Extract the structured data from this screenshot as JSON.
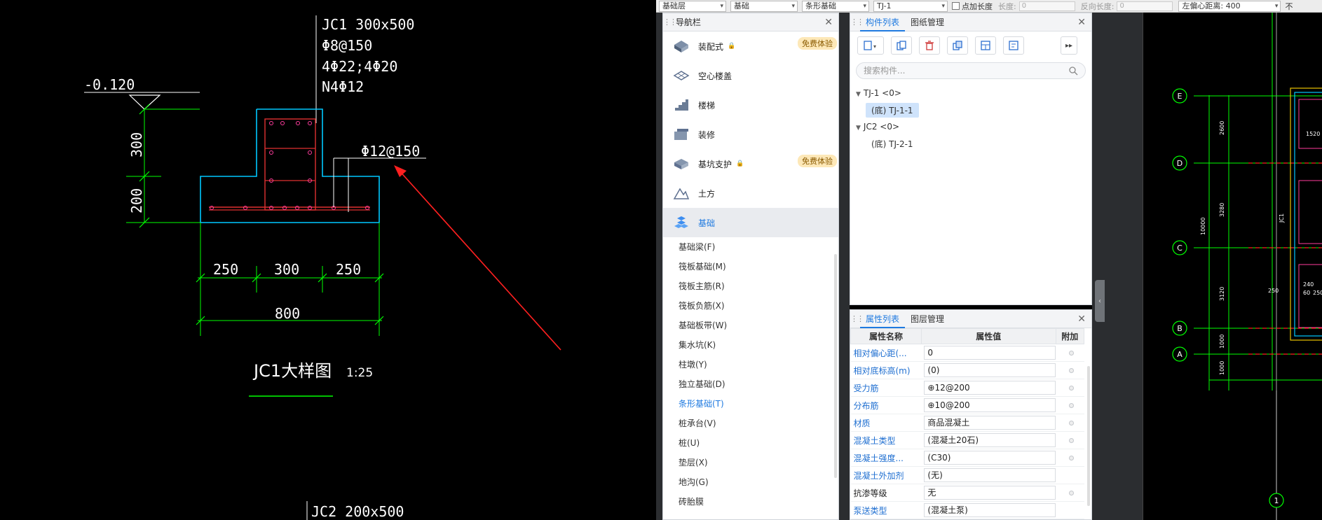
{
  "top_strip": {
    "combo1": "基础层",
    "combo2": "基础",
    "combo3": "条形基础",
    "combo4": "TJ-1",
    "add_length_label": "点加长度",
    "length_label": "长度:",
    "length_value": "0",
    "reverse_length_label": "反向长度:",
    "reverse_length_value": "0",
    "left_offset": "左偏心距离: 400",
    "right_cut": "不"
  },
  "drawing": {
    "elev_label": "-0.120",
    "header_line1": "JC1 300x500",
    "header_line2": "Φ8@150",
    "header_line3": "4Φ22;4Φ20",
    "header_line4": "N4Φ12",
    "rebar_label": "Φ12@150",
    "dim_300_v": "300",
    "dim_200_v": "200",
    "dim_250_a": "250",
    "dim_300_h": "300",
    "dim_250_b": "250",
    "dim_800": "800",
    "title": "JC1大样图",
    "scale": "1:25",
    "bottom_label": "JC2 200x500"
  },
  "nav": {
    "title": "导航栏",
    "main_items": [
      {
        "label": "装配式",
        "lock": true,
        "badge": "免费体验",
        "icon": "prefab-icon"
      },
      {
        "label": "空心楼盖",
        "lock": false,
        "badge": "",
        "icon": "hollow-slab-icon"
      },
      {
        "label": "楼梯",
        "lock": false,
        "badge": "",
        "icon": "stairs-icon"
      },
      {
        "label": "装修",
        "lock": false,
        "badge": "",
        "icon": "decoration-icon"
      },
      {
        "label": "基坑支护",
        "lock": true,
        "badge": "免费体验",
        "icon": "pit-support-icon"
      },
      {
        "label": "土方",
        "lock": false,
        "badge": "",
        "icon": "earthwork-icon"
      },
      {
        "label": "基础",
        "lock": false,
        "badge": "",
        "icon": "foundation-icon"
      }
    ],
    "sub_items": [
      "基础梁(F)",
      "筏板基础(M)",
      "筏板主筋(R)",
      "筏板负筋(X)",
      "基础板带(W)",
      "集水坑(K)",
      "柱墩(Y)",
      "独立基础(D)",
      "条形基础(T)",
      "桩承台(V)",
      "桩(U)",
      "垫层(X)",
      "地沟(G)",
      "砖胎膜"
    ]
  },
  "component_panel": {
    "tab1": "构件列表",
    "tab2": "图纸管理",
    "search_placeholder": "搜索构件...",
    "group1": "TJ-1 <0>",
    "item1": "(底) TJ-1-1",
    "group2": "JC2 <0>",
    "item2": "(底) TJ-2-1"
  },
  "property_panel": {
    "tab1": "属性列表",
    "tab2": "图层管理",
    "col_name": "属性名称",
    "col_value": "属性值",
    "col_add": "附加",
    "rows": [
      {
        "name": "相对偏心距(...",
        "value": "0",
        "blue": true,
        "check": true
      },
      {
        "name": "相对底标高(m)",
        "value": "(0)",
        "blue": true,
        "check": true
      },
      {
        "name": "受力筋",
        "value": "⊕12@200",
        "blue": true,
        "check": true
      },
      {
        "name": "分布筋",
        "value": "⊕10@200",
        "blue": true,
        "check": true
      },
      {
        "name": "材质",
        "value": "商品混凝土",
        "blue": true,
        "check": true
      },
      {
        "name": "混凝土类型",
        "value": "(混凝土20石)",
        "blue": true,
        "check": true
      },
      {
        "name": "混凝土强度...",
        "value": "(C30)",
        "blue": true,
        "check": true
      },
      {
        "name": "混凝土外加剂",
        "value": "(无)",
        "blue": true,
        "check": false
      },
      {
        "name": "抗渗等级",
        "value": "无",
        "blue": false,
        "check": true
      },
      {
        "name": "泵送类型",
        "value": "(混凝土泵)",
        "blue": true,
        "check": false
      }
    ]
  },
  "plan": {
    "axes": [
      "E",
      "D",
      "C",
      "B",
      "A",
      "1"
    ],
    "dims": [
      "2600",
      "3280",
      "3120",
      "1000",
      "1000",
      "10000",
      "1520",
      "240",
      "60",
      "250",
      "250",
      "JC1"
    ]
  },
  "colors": {
    "accent": "#1f7ae0",
    "cad_bg": "#000000",
    "cad_green": "#00ff00",
    "cad_cyan": "#00c8ff"
  }
}
